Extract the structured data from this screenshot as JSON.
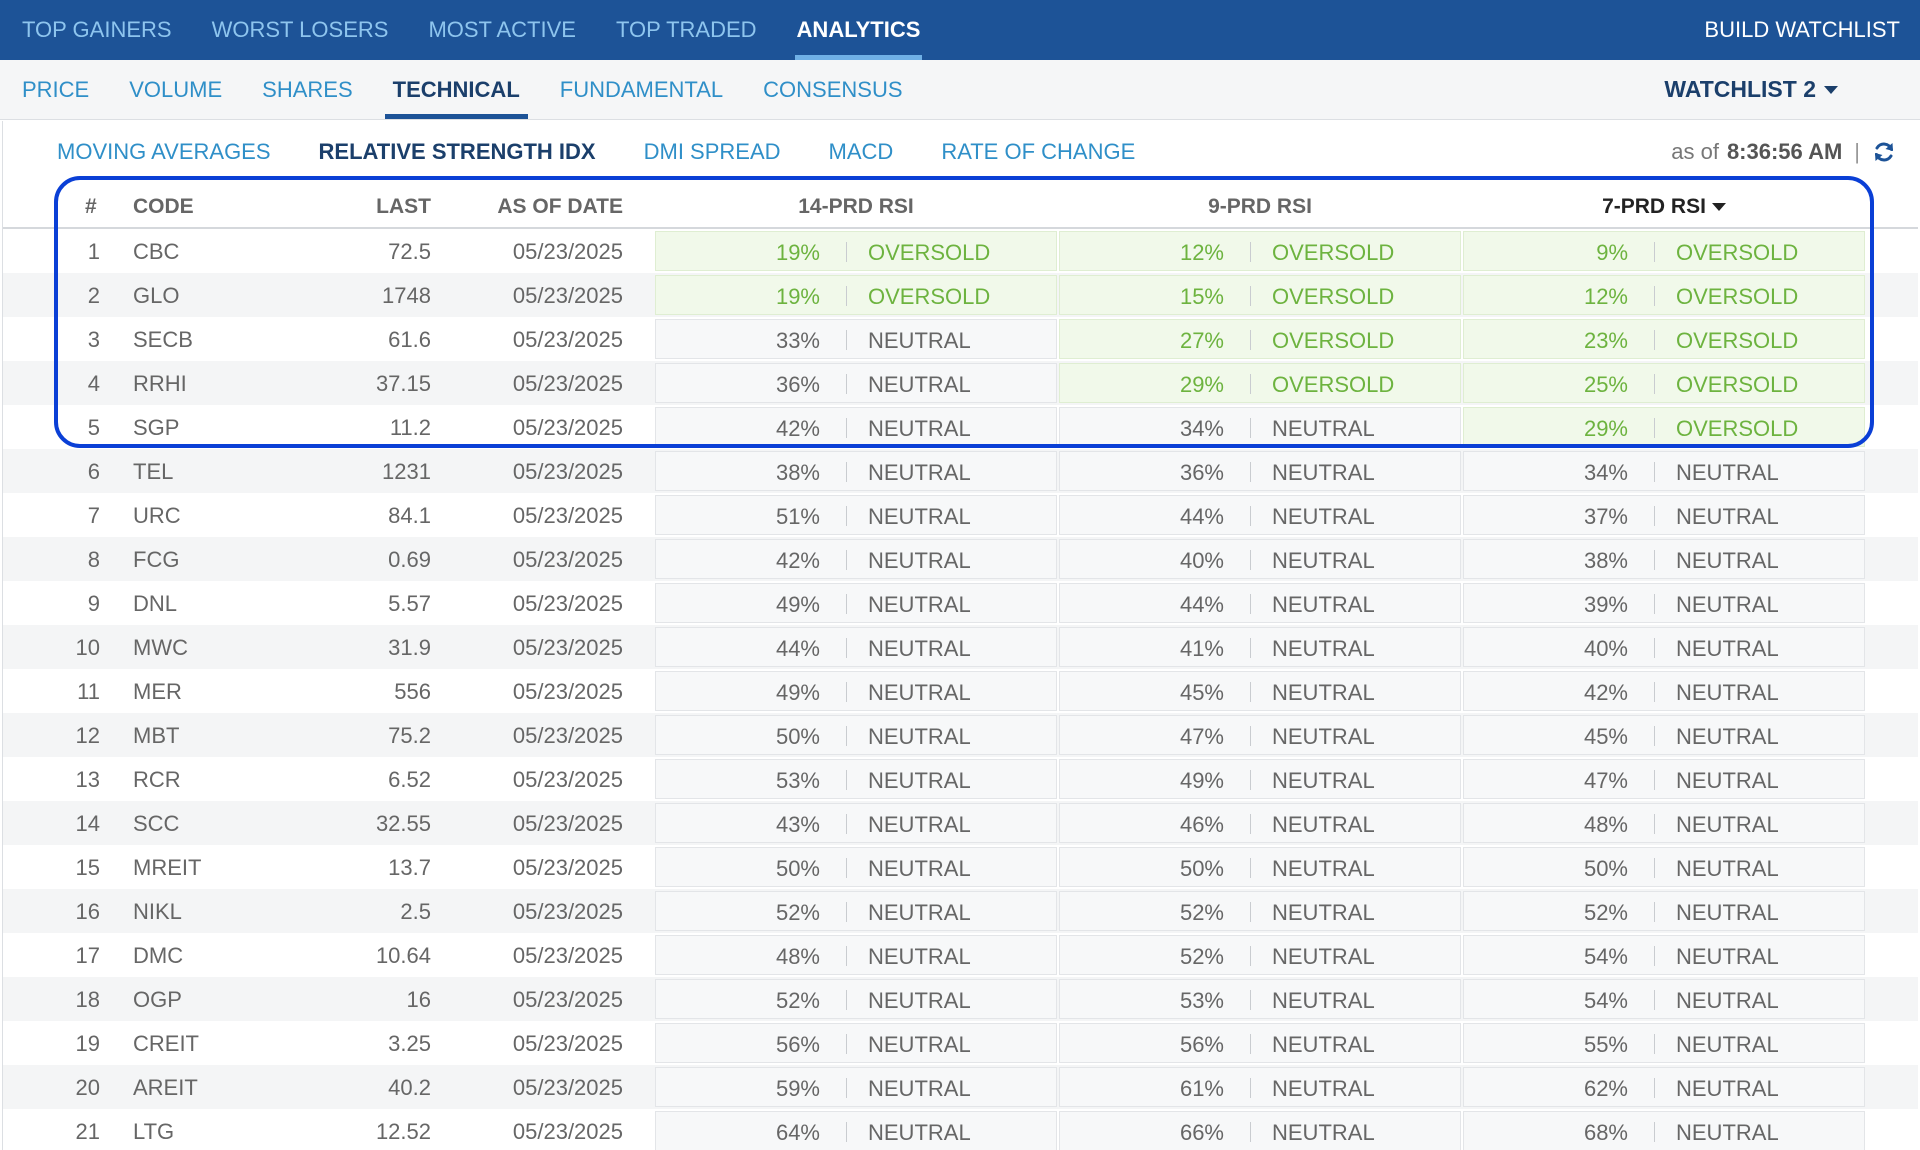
{
  "topnav": {
    "tabs": [
      {
        "label": "TOP GAINERS"
      },
      {
        "label": "WORST LOSERS"
      },
      {
        "label": "MOST ACTIVE"
      },
      {
        "label": "TOP TRADED"
      },
      {
        "label": "ANALYTICS",
        "active": true
      }
    ],
    "build_watchlist": "BUILD WATCHLIST"
  },
  "subnav": {
    "tabs": [
      {
        "label": "PRICE"
      },
      {
        "label": "VOLUME"
      },
      {
        "label": "SHARES"
      },
      {
        "label": "TECHNICAL",
        "active": true
      },
      {
        "label": "FUNDAMENTAL"
      },
      {
        "label": "CONSENSUS"
      }
    ],
    "watchlist": "WATCHLIST 2"
  },
  "thirdnav": {
    "tabs": [
      {
        "label": "MOVING AVERAGES"
      },
      {
        "label": "RELATIVE STRENGTH IDX",
        "active": true
      },
      {
        "label": "DMI SPREAD"
      },
      {
        "label": "MACD"
      },
      {
        "label": "RATE OF CHANGE"
      }
    ],
    "as_of_label": "as of",
    "as_of_time": "8:36:56 AM",
    "separator": "|"
  },
  "table": {
    "headers": {
      "num": "#",
      "code": "CODE",
      "last": "LAST",
      "date": "AS OF DATE",
      "rsi14": "14-PRD RSI",
      "rsi9": "9-PRD RSI",
      "rsi7": "7-PRD RSI"
    },
    "rows": [
      {
        "num": "1",
        "code": "CBC",
        "last": "72.5",
        "date": "05/23/2025",
        "rsi14": "19%",
        "s14": "OVERSOLD",
        "rsi9": "12%",
        "s9": "OVERSOLD",
        "rsi7": "9%",
        "s7": "OVERSOLD"
      },
      {
        "num": "2",
        "code": "GLO",
        "last": "1748",
        "date": "05/23/2025",
        "rsi14": "19%",
        "s14": "OVERSOLD",
        "rsi9": "15%",
        "s9": "OVERSOLD",
        "rsi7": "12%",
        "s7": "OVERSOLD"
      },
      {
        "num": "3",
        "code": "SECB",
        "last": "61.6",
        "date": "05/23/2025",
        "rsi14": "33%",
        "s14": "NEUTRAL",
        "rsi9": "27%",
        "s9": "OVERSOLD",
        "rsi7": "23%",
        "s7": "OVERSOLD"
      },
      {
        "num": "4",
        "code": "RRHI",
        "last": "37.15",
        "date": "05/23/2025",
        "rsi14": "36%",
        "s14": "NEUTRAL",
        "rsi9": "29%",
        "s9": "OVERSOLD",
        "rsi7": "25%",
        "s7": "OVERSOLD"
      },
      {
        "num": "5",
        "code": "SGP",
        "last": "11.2",
        "date": "05/23/2025",
        "rsi14": "42%",
        "s14": "NEUTRAL",
        "rsi9": "34%",
        "s9": "NEUTRAL",
        "rsi7": "29%",
        "s7": "OVERSOLD"
      },
      {
        "num": "6",
        "code": "TEL",
        "last": "1231",
        "date": "05/23/2025",
        "rsi14": "38%",
        "s14": "NEUTRAL",
        "rsi9": "36%",
        "s9": "NEUTRAL",
        "rsi7": "34%",
        "s7": "NEUTRAL"
      },
      {
        "num": "7",
        "code": "URC",
        "last": "84.1",
        "date": "05/23/2025",
        "rsi14": "51%",
        "s14": "NEUTRAL",
        "rsi9": "44%",
        "s9": "NEUTRAL",
        "rsi7": "37%",
        "s7": "NEUTRAL"
      },
      {
        "num": "8",
        "code": "FCG",
        "last": "0.69",
        "date": "05/23/2025",
        "rsi14": "42%",
        "s14": "NEUTRAL",
        "rsi9": "40%",
        "s9": "NEUTRAL",
        "rsi7": "38%",
        "s7": "NEUTRAL"
      },
      {
        "num": "9",
        "code": "DNL",
        "last": "5.57",
        "date": "05/23/2025",
        "rsi14": "49%",
        "s14": "NEUTRAL",
        "rsi9": "44%",
        "s9": "NEUTRAL",
        "rsi7": "39%",
        "s7": "NEUTRAL"
      },
      {
        "num": "10",
        "code": "MWC",
        "last": "31.9",
        "date": "05/23/2025",
        "rsi14": "44%",
        "s14": "NEUTRAL",
        "rsi9": "41%",
        "s9": "NEUTRAL",
        "rsi7": "40%",
        "s7": "NEUTRAL"
      },
      {
        "num": "11",
        "code": "MER",
        "last": "556",
        "date": "05/23/2025",
        "rsi14": "49%",
        "s14": "NEUTRAL",
        "rsi9": "45%",
        "s9": "NEUTRAL",
        "rsi7": "42%",
        "s7": "NEUTRAL"
      },
      {
        "num": "12",
        "code": "MBT",
        "last": "75.2",
        "date": "05/23/2025",
        "rsi14": "50%",
        "s14": "NEUTRAL",
        "rsi9": "47%",
        "s9": "NEUTRAL",
        "rsi7": "45%",
        "s7": "NEUTRAL"
      },
      {
        "num": "13",
        "code": "RCR",
        "last": "6.52",
        "date": "05/23/2025",
        "rsi14": "53%",
        "s14": "NEUTRAL",
        "rsi9": "49%",
        "s9": "NEUTRAL",
        "rsi7": "47%",
        "s7": "NEUTRAL"
      },
      {
        "num": "14",
        "code": "SCC",
        "last": "32.55",
        "date": "05/23/2025",
        "rsi14": "43%",
        "s14": "NEUTRAL",
        "rsi9": "46%",
        "s9": "NEUTRAL",
        "rsi7": "48%",
        "s7": "NEUTRAL"
      },
      {
        "num": "15",
        "code": "MREIT",
        "last": "13.7",
        "date": "05/23/2025",
        "rsi14": "50%",
        "s14": "NEUTRAL",
        "rsi9": "50%",
        "s9": "NEUTRAL",
        "rsi7": "50%",
        "s7": "NEUTRAL"
      },
      {
        "num": "16",
        "code": "NIKL",
        "last": "2.5",
        "date": "05/23/2025",
        "rsi14": "52%",
        "s14": "NEUTRAL",
        "rsi9": "52%",
        "s9": "NEUTRAL",
        "rsi7": "52%",
        "s7": "NEUTRAL"
      },
      {
        "num": "17",
        "code": "DMC",
        "last": "10.64",
        "date": "05/23/2025",
        "rsi14": "48%",
        "s14": "NEUTRAL",
        "rsi9": "52%",
        "s9": "NEUTRAL",
        "rsi7": "54%",
        "s7": "NEUTRAL"
      },
      {
        "num": "18",
        "code": "OGP",
        "last": "16",
        "date": "05/23/2025",
        "rsi14": "52%",
        "s14": "NEUTRAL",
        "rsi9": "53%",
        "s9": "NEUTRAL",
        "rsi7": "54%",
        "s7": "NEUTRAL"
      },
      {
        "num": "19",
        "code": "CREIT",
        "last": "3.25",
        "date": "05/23/2025",
        "rsi14": "56%",
        "s14": "NEUTRAL",
        "rsi9": "56%",
        "s9": "NEUTRAL",
        "rsi7": "55%",
        "s7": "NEUTRAL"
      },
      {
        "num": "20",
        "code": "AREIT",
        "last": "40.2",
        "date": "05/23/2025",
        "rsi14": "59%",
        "s14": "NEUTRAL",
        "rsi9": "61%",
        "s9": "NEUTRAL",
        "rsi7": "62%",
        "s7": "NEUTRAL"
      },
      {
        "num": "21",
        "code": "LTG",
        "last": "12.52",
        "date": "05/23/2025",
        "rsi14": "64%",
        "s14": "NEUTRAL",
        "rsi9": "66%",
        "s9": "NEUTRAL",
        "rsi7": "68%",
        "s7": "NEUTRAL"
      }
    ]
  },
  "colors": {
    "topnav_bg": "#1d5397",
    "oversold_green": "#6db33f",
    "highlight_border": "#0a3fd6"
  },
  "icons": {
    "refresh": "refresh-icon",
    "sort_caret": "caret-down-icon"
  }
}
